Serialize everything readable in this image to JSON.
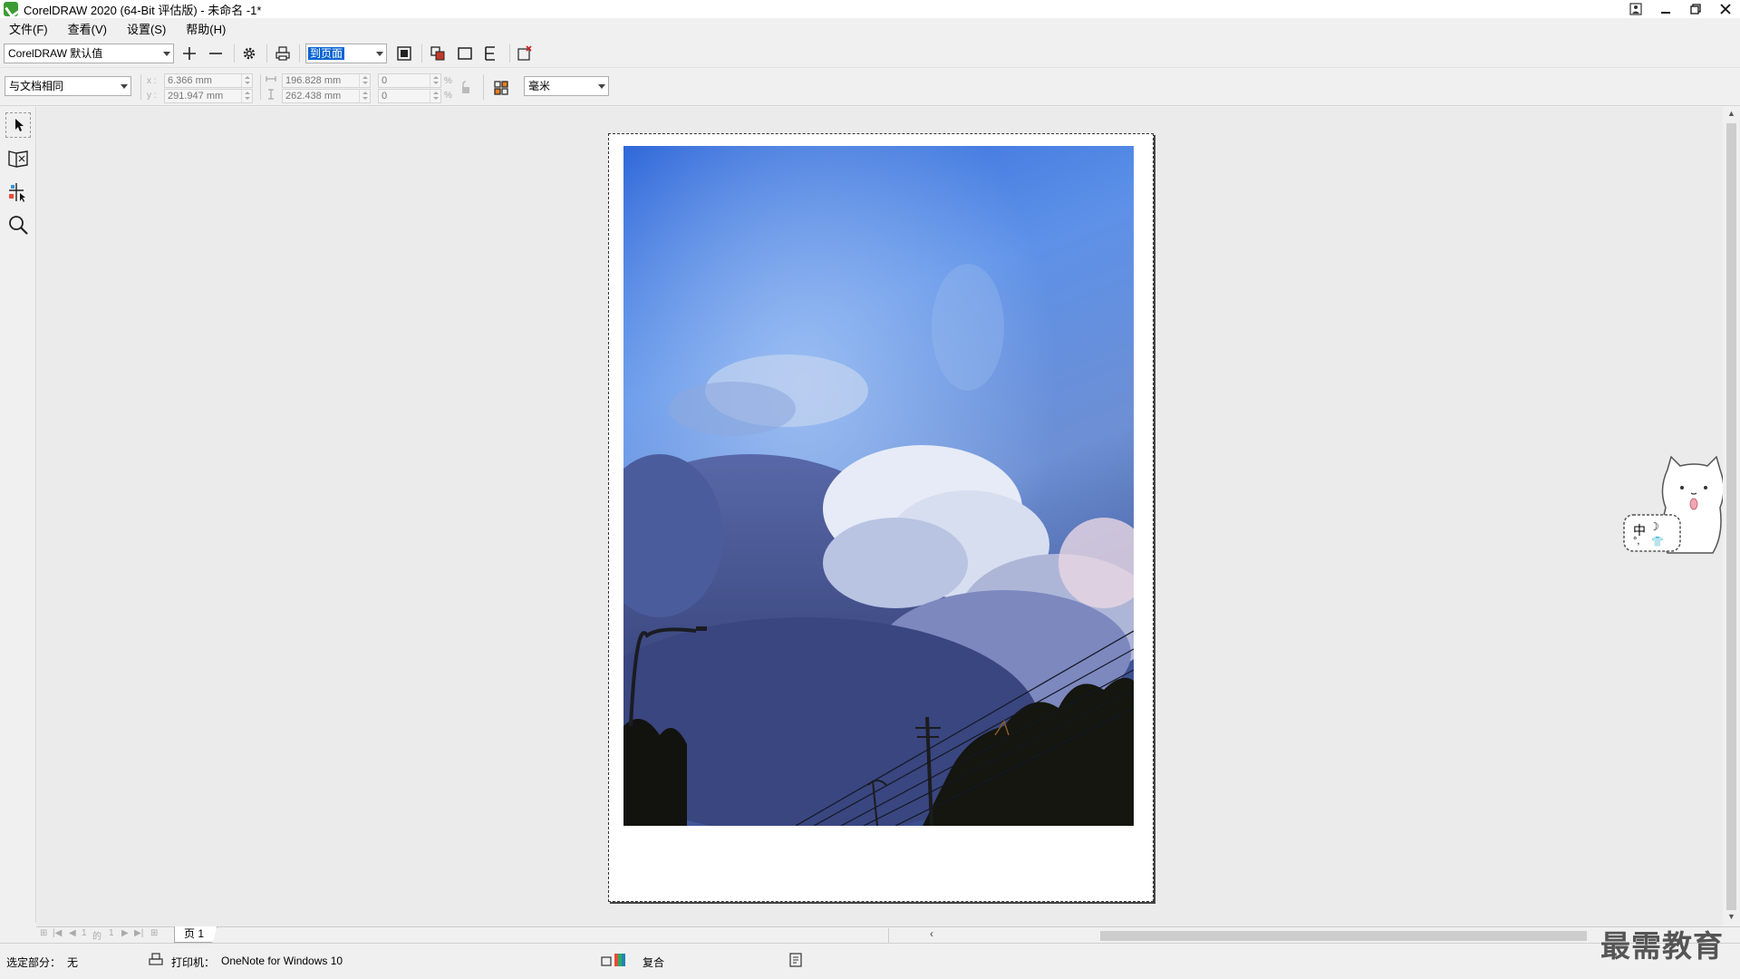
{
  "window": {
    "title": "CorelDRAW 2020 (64-Bit 评估版) - 未命名 -1*"
  },
  "menu": {
    "items": [
      {
        "label": "文件(F)"
      },
      {
        "label": "查看(V)"
      },
      {
        "label": "设置(S)"
      },
      {
        "label": "帮助(H)"
      }
    ]
  },
  "toolbar": {
    "preset_value": "CorelDRAW 默认值",
    "zoom_value": "到页面",
    "icons": [
      "add-icon",
      "remove-icon",
      "gear-icon",
      "print-icon",
      "zoom-to-fit-icon",
      "zoom-objects-icon",
      "full-screen-icon",
      "edit-icon",
      "close-preview-icon"
    ]
  },
  "property_bar": {
    "page_size_value": "与文档相同",
    "x_label": "x :",
    "y_label": "y :",
    "x_value": "6.366 mm",
    "y_value": "291.947 mm",
    "width_value": "196.828 mm",
    "height_value": "262.438 mm",
    "scale_x_value": "0",
    "scale_y_value": "0",
    "percent_symbol": "%",
    "units_value": "毫米"
  },
  "pager": {
    "current": "1",
    "of_label": "的",
    "total": "1",
    "tab_label": "页 1"
  },
  "status": {
    "selection_label": "选定部分：",
    "selection_value": "无",
    "printer_label": "打印机：",
    "printer_value": "OneNote for Windows 10",
    "mode_label": "复合"
  },
  "ime": {
    "label": "中"
  },
  "watermark": {
    "text": "最需教育"
  },
  "colors": {
    "sky_top": "#2d66d8",
    "sky_mid": "#5d91e8",
    "cloud": "#e8ecf6",
    "accent_green": "#3b9c33"
  }
}
